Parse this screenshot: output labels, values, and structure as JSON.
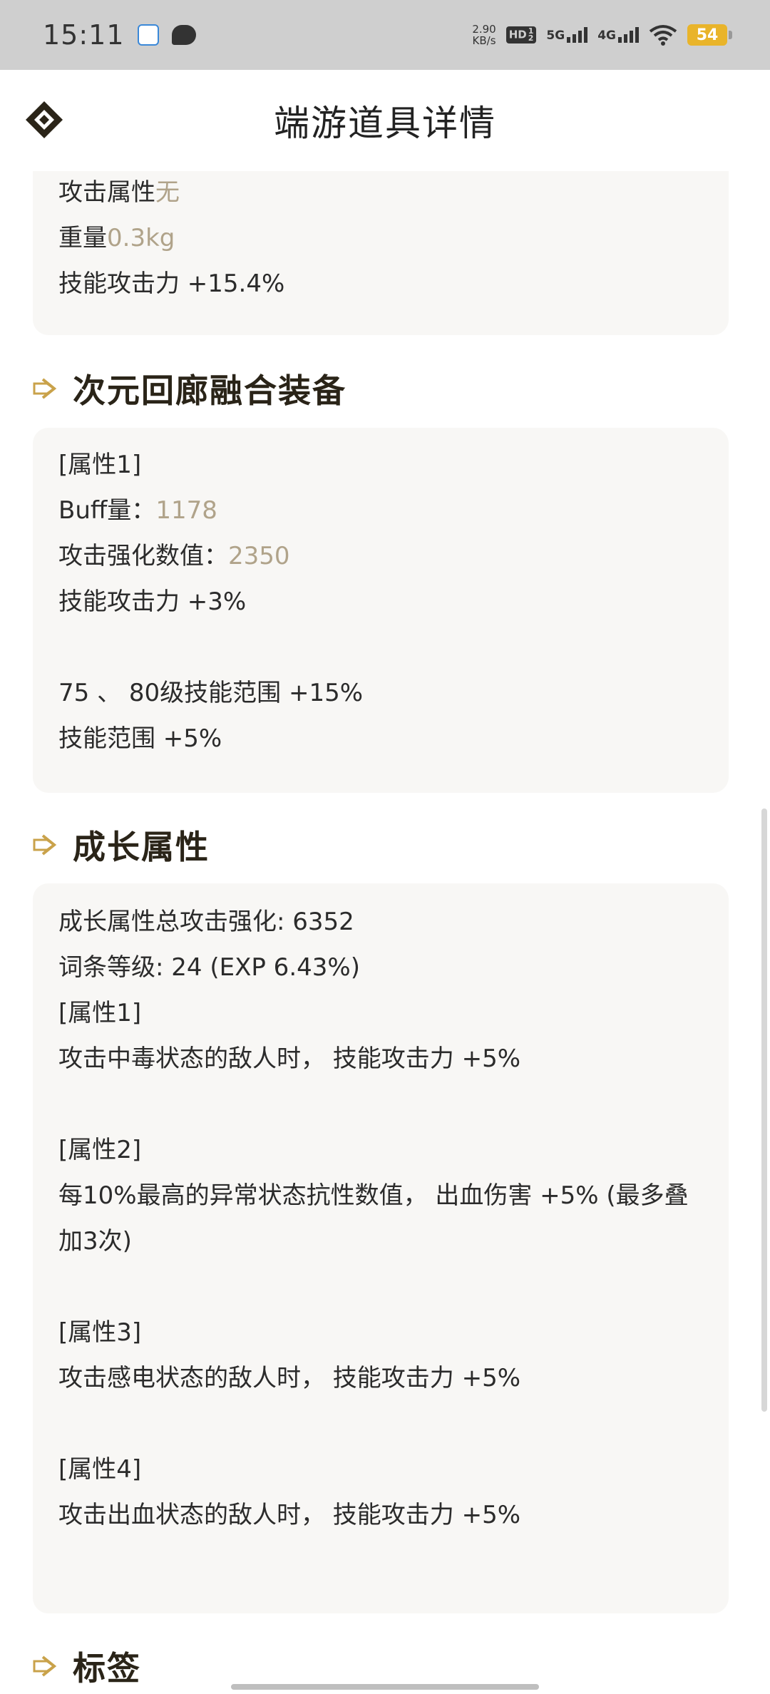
{
  "status_bar": {
    "time": "15:11",
    "net_speed_value": "2.90",
    "net_speed_unit": "KB/s",
    "hd_label": "HD",
    "hd_sub": "1\n2",
    "signal_5g": "5G",
    "signal_4g": "4G",
    "battery": "54",
    "icons": [
      "notification-app-icon",
      "chat-icon",
      "hd-voice-icon",
      "signal-icon",
      "wifi-icon",
      "battery-icon"
    ],
    "battery_color": "#e9b42a"
  },
  "header": {
    "title": "端游道具详情",
    "logo_icon": "diamond-logo-icon"
  },
  "top_card": {
    "lines": [
      {
        "label": "攻击属性",
        "value": "无"
      },
      {
        "label": "重量",
        "value": "0.3kg"
      },
      {
        "label": "技能攻击力 +15.4%",
        "value": ""
      }
    ]
  },
  "fusion_section": {
    "title": "次元回廊融合装备",
    "lines": [
      {
        "label": "[属性1]",
        "value": ""
      },
      {
        "label": "Buff量：",
        "value": "1178"
      },
      {
        "label": "攻击强化数值：",
        "value": "2350"
      },
      {
        "label": "技能攻击力 +3%",
        "value": ""
      },
      {
        "label": "",
        "value": ""
      },
      {
        "label": "75 、 80级技能范围 +15%",
        "value": ""
      },
      {
        "label": "技能范围 +5%",
        "value": ""
      }
    ]
  },
  "growth_section": {
    "title": "成长属性",
    "lines": [
      "成长属性总攻击强化: 6352",
      "词条等级: 24 (EXP 6.43%)",
      "[属性1]",
      "攻击中毒状态的敌人时， 技能攻击力 +5%",
      "",
      "[属性2]",
      "每10%最高的异常状态抗性数值， 出血伤害 +5% (最多叠加3次)",
      "",
      "[属性3]",
      "攻击感电状态的敌人时， 技能攻击力 +5%",
      "",
      "[属性4]",
      "攻击出血状态的敌人时， 技能攻击力 +5%"
    ]
  },
  "tags_section": {
    "title": "标签"
  },
  "colors": {
    "accent_gold": "#c9a24a",
    "value_tan": "#b0a38a",
    "card_bg": "#f8f7f5",
    "title_dark": "#2a2418"
  }
}
